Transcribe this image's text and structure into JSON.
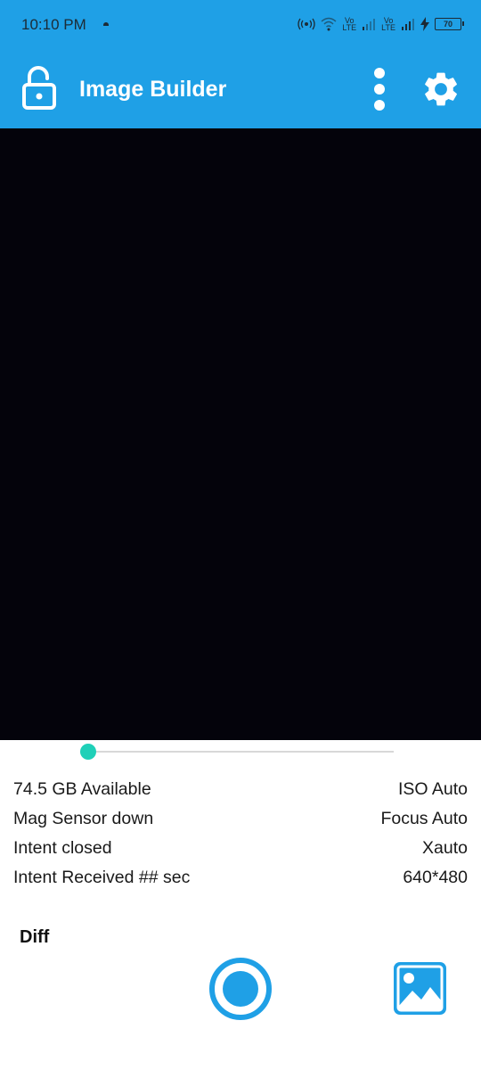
{
  "status_bar": {
    "time": "10:10 PM",
    "sim1_label_top": "Vo",
    "sim1_label_bottom": "LTE",
    "sim2_label_top": "Vo",
    "sim2_label_bottom": "LTE",
    "battery": "70"
  },
  "app_bar": {
    "title": "Image Builder"
  },
  "slider": {
    "value_fraction": 0.0
  },
  "info": {
    "left": [
      "74.5 GB Available",
      "Mag Sensor down",
      "Intent closed",
      "Intent Received ## sec"
    ],
    "right": [
      "ISO Auto",
      "Focus Auto",
      "Xauto",
      "640*480"
    ]
  },
  "diff_label": "Diff",
  "colors": {
    "primary": "#1fa0e6",
    "accent": "#1fd0b8",
    "preview": "#04030b"
  }
}
